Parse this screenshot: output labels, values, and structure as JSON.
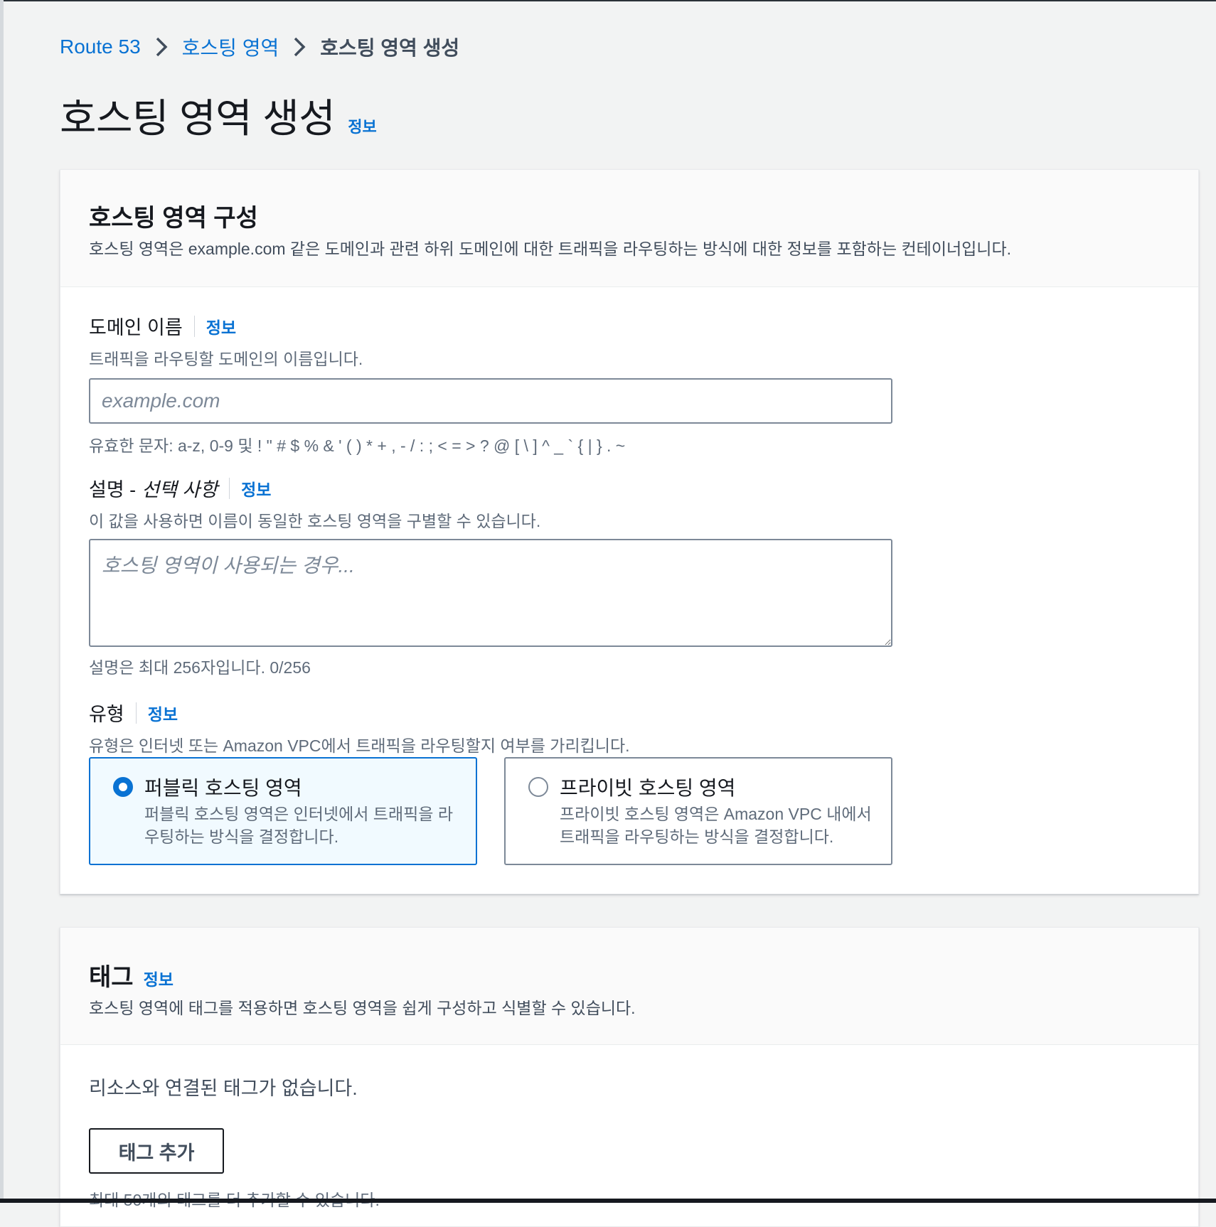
{
  "breadcrumb": {
    "items": [
      "Route 53",
      "호스팅 영역"
    ],
    "current": "호스팅 영역 생성"
  },
  "page": {
    "title": "호스팅 영역 생성",
    "info": "정보"
  },
  "config_panel": {
    "title": "호스팅 영역 구성",
    "description": "호스팅 영역은 example.com 같은 도메인과 관련 하위 도메인에 대한 트래픽을 라우팅하는 방식에 대한 정보를 포함하는 컨테이너입니다.",
    "domain": {
      "label": "도메인 이름",
      "info": "정보",
      "description": "트래픽을 라우팅할 도메인의 이름입니다.",
      "placeholder": "example.com",
      "value": "",
      "constraint": "유효한 문자: a-z, 0-9 및 ! \" # $ % & ' ( ) * + , - / : ; < = > ? @ [ \\ ] ^ _ ` { | } . ~"
    },
    "description_field": {
      "label": "설명 - ",
      "optional": "선택 사항",
      "info": "정보",
      "description": "이 값을 사용하면 이름이 동일한 호스팅 영역을 구별할 수 있습니다.",
      "placeholder": "호스팅 영역이 사용되는 경우...",
      "value": "",
      "constraint": "설명은 최대 256자입니다. 0/256"
    },
    "type": {
      "label": "유형",
      "info": "정보",
      "description": "유형은 인터넷 또는 Amazon VPC에서 트래픽을 라우팅할지 여부를 가리킵니다.",
      "options": [
        {
          "title": "퍼블릭 호스팅 영역",
          "description": "퍼블릭 호스팅 영역은 인터넷에서 트래픽을 라우팅하는 방식을 결정합니다.",
          "selected": true
        },
        {
          "title": "프라이빗 호스팅 영역",
          "description": "프라이빗 호스팅 영역은 Amazon VPC 내에서 트래픽을 라우팅하는 방식을 결정합니다.",
          "selected": false
        }
      ]
    }
  },
  "tags_panel": {
    "title": "태그",
    "info": "정보",
    "description": "호스팅 영역에 태그를 적용하면 호스팅 영역을 쉽게 구성하고 식별할 수 있습니다.",
    "empty": "리소스와 연결된 태그가 없습니다.",
    "add_button": "태그 추가",
    "limit": "최대 50개의 태그를 더 추가할 수 있습니다."
  },
  "colors": {
    "link": "#0972d3",
    "selected_tile_bg": "#f1faff",
    "page_bg": "#f2f3f3"
  }
}
